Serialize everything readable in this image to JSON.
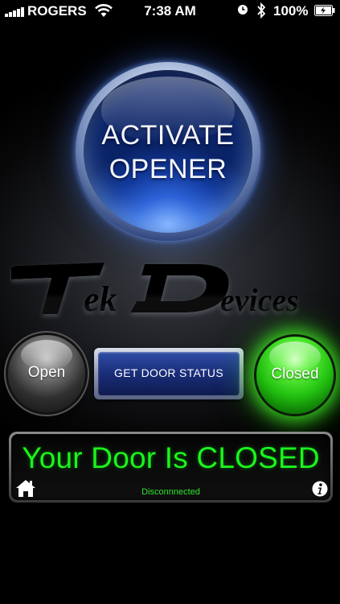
{
  "status_bar": {
    "carrier": "ROGERS",
    "time": "7:38 AM",
    "battery_percent": "100%",
    "icons": [
      "signal-icon",
      "wifi-icon",
      "alarm-clock-icon",
      "bluetooth-icon",
      "battery-charging-icon"
    ]
  },
  "activate_button": {
    "line1": "ACTIVATE",
    "line2": "OPENER"
  },
  "logo": {
    "text": "TekDevices"
  },
  "open_button": {
    "label": "Open"
  },
  "status_button": {
    "label": "GET DOOR STATUS"
  },
  "closed_button": {
    "label": "Closed"
  },
  "display": {
    "message": "Your Door Is CLOSED",
    "connection": "Disconnnected",
    "icons": [
      "home-icon",
      "info-icon"
    ]
  },
  "colors": {
    "display_text": "#19f51c",
    "accent_blue": "#2d63d8",
    "closed_green": "#22c010"
  }
}
